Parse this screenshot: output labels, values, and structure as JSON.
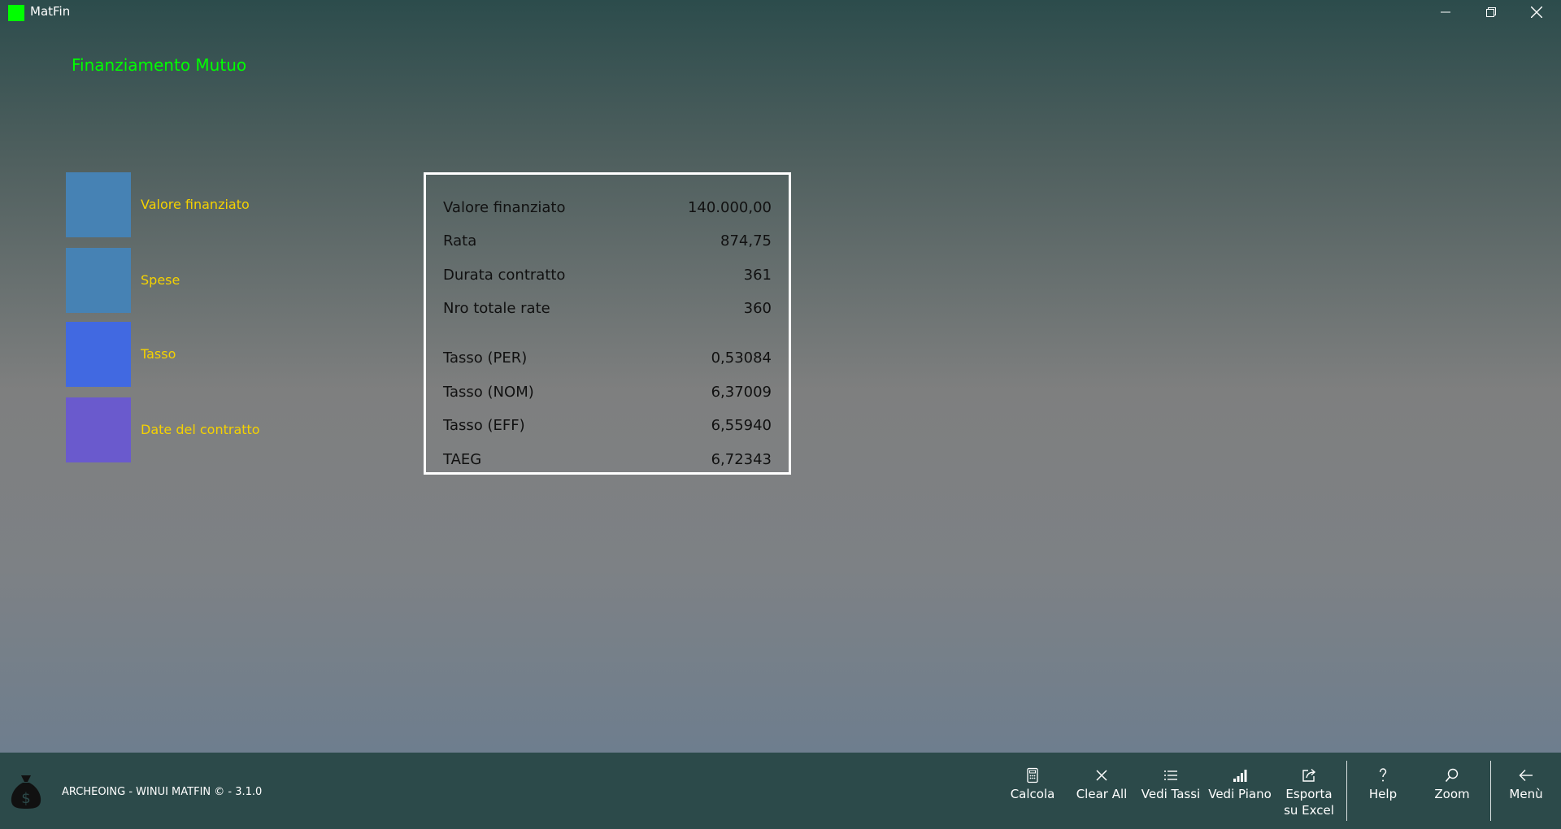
{
  "window": {
    "title": "MatFin",
    "controls": [
      "minimize",
      "restore",
      "close"
    ]
  },
  "page": {
    "title": "Finanziamento Mutuo"
  },
  "tiles": [
    {
      "label": "Valore finanziato",
      "color": "#4682b4"
    },
    {
      "label": "Spese",
      "color": "#4682b4"
    },
    {
      "label": "Tasso",
      "color": "#4169e1"
    },
    {
      "label": "Date del contratto",
      "color": "#6a5acd"
    }
  ],
  "summary": [
    {
      "label": "Valore finanziato",
      "value": "140.000,00"
    },
    {
      "label": "Rata",
      "value": "874,75"
    },
    {
      "label": "Durata contratto",
      "value": "361"
    },
    {
      "label": "Nro totale rate",
      "value": "360"
    },
    {
      "label": "Tasso (PER)",
      "value": "0,53084"
    },
    {
      "label": "Tasso (NOM)",
      "value": "6,37009"
    },
    {
      "label": "Tasso (EFF)",
      "value": "6,55940"
    },
    {
      "label": "TAEG",
      "value": "6,72343"
    }
  ],
  "footer": {
    "brand": "ARCHEOING - WINUI MATFIN © - 3.1.0",
    "icon": "money-bag-icon"
  },
  "commands": [
    {
      "label": "Calcola",
      "icon": "calculator-icon"
    },
    {
      "label": "Clear All",
      "icon": "close-icon"
    },
    {
      "label": "Vedi Tassi",
      "icon": "list-icon"
    },
    {
      "label": "Vedi Piano",
      "icon": "bar-chart-icon"
    },
    {
      "label": "Esporta su Excel",
      "icon": "share-icon"
    },
    {
      "label": "Help",
      "icon": "question-icon"
    },
    {
      "label": "Zoom",
      "icon": "search-icon"
    },
    {
      "label": "Menù",
      "icon": "back-arrow-icon"
    }
  ]
}
